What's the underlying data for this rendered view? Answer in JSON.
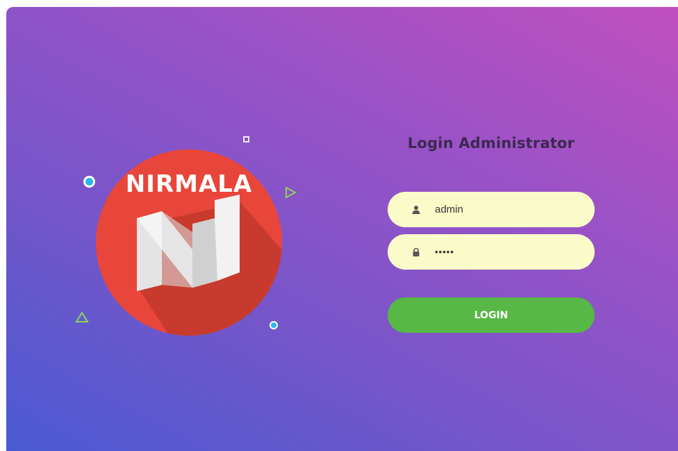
{
  "logo": {
    "text": "NIRMALA",
    "letter": "N",
    "colors": {
      "circle": "#e8463a",
      "shadow": "#c2382c",
      "letter_face": "#f2f2f2",
      "letter_side": "#d6d6d6"
    }
  },
  "decorations": {
    "ring_icon": "ring",
    "square_icon": "square-outline",
    "triangle_right_icon": "triangle-right-outline",
    "triangle_up_icon": "triangle-up-outline",
    "dot_icon": "dot"
  },
  "login": {
    "title": "Login Administrator",
    "username": {
      "icon": "user-icon",
      "value": "admin"
    },
    "password": {
      "icon": "lock-icon",
      "value": "•••••"
    },
    "button_label": "LOGIN"
  },
  "colors": {
    "background_start": "#4a5ad3",
    "background_end": "#c04fbf",
    "input_bg": "#fbfbc9",
    "button_bg": "#57b846",
    "title_color": "#3a2a50"
  }
}
